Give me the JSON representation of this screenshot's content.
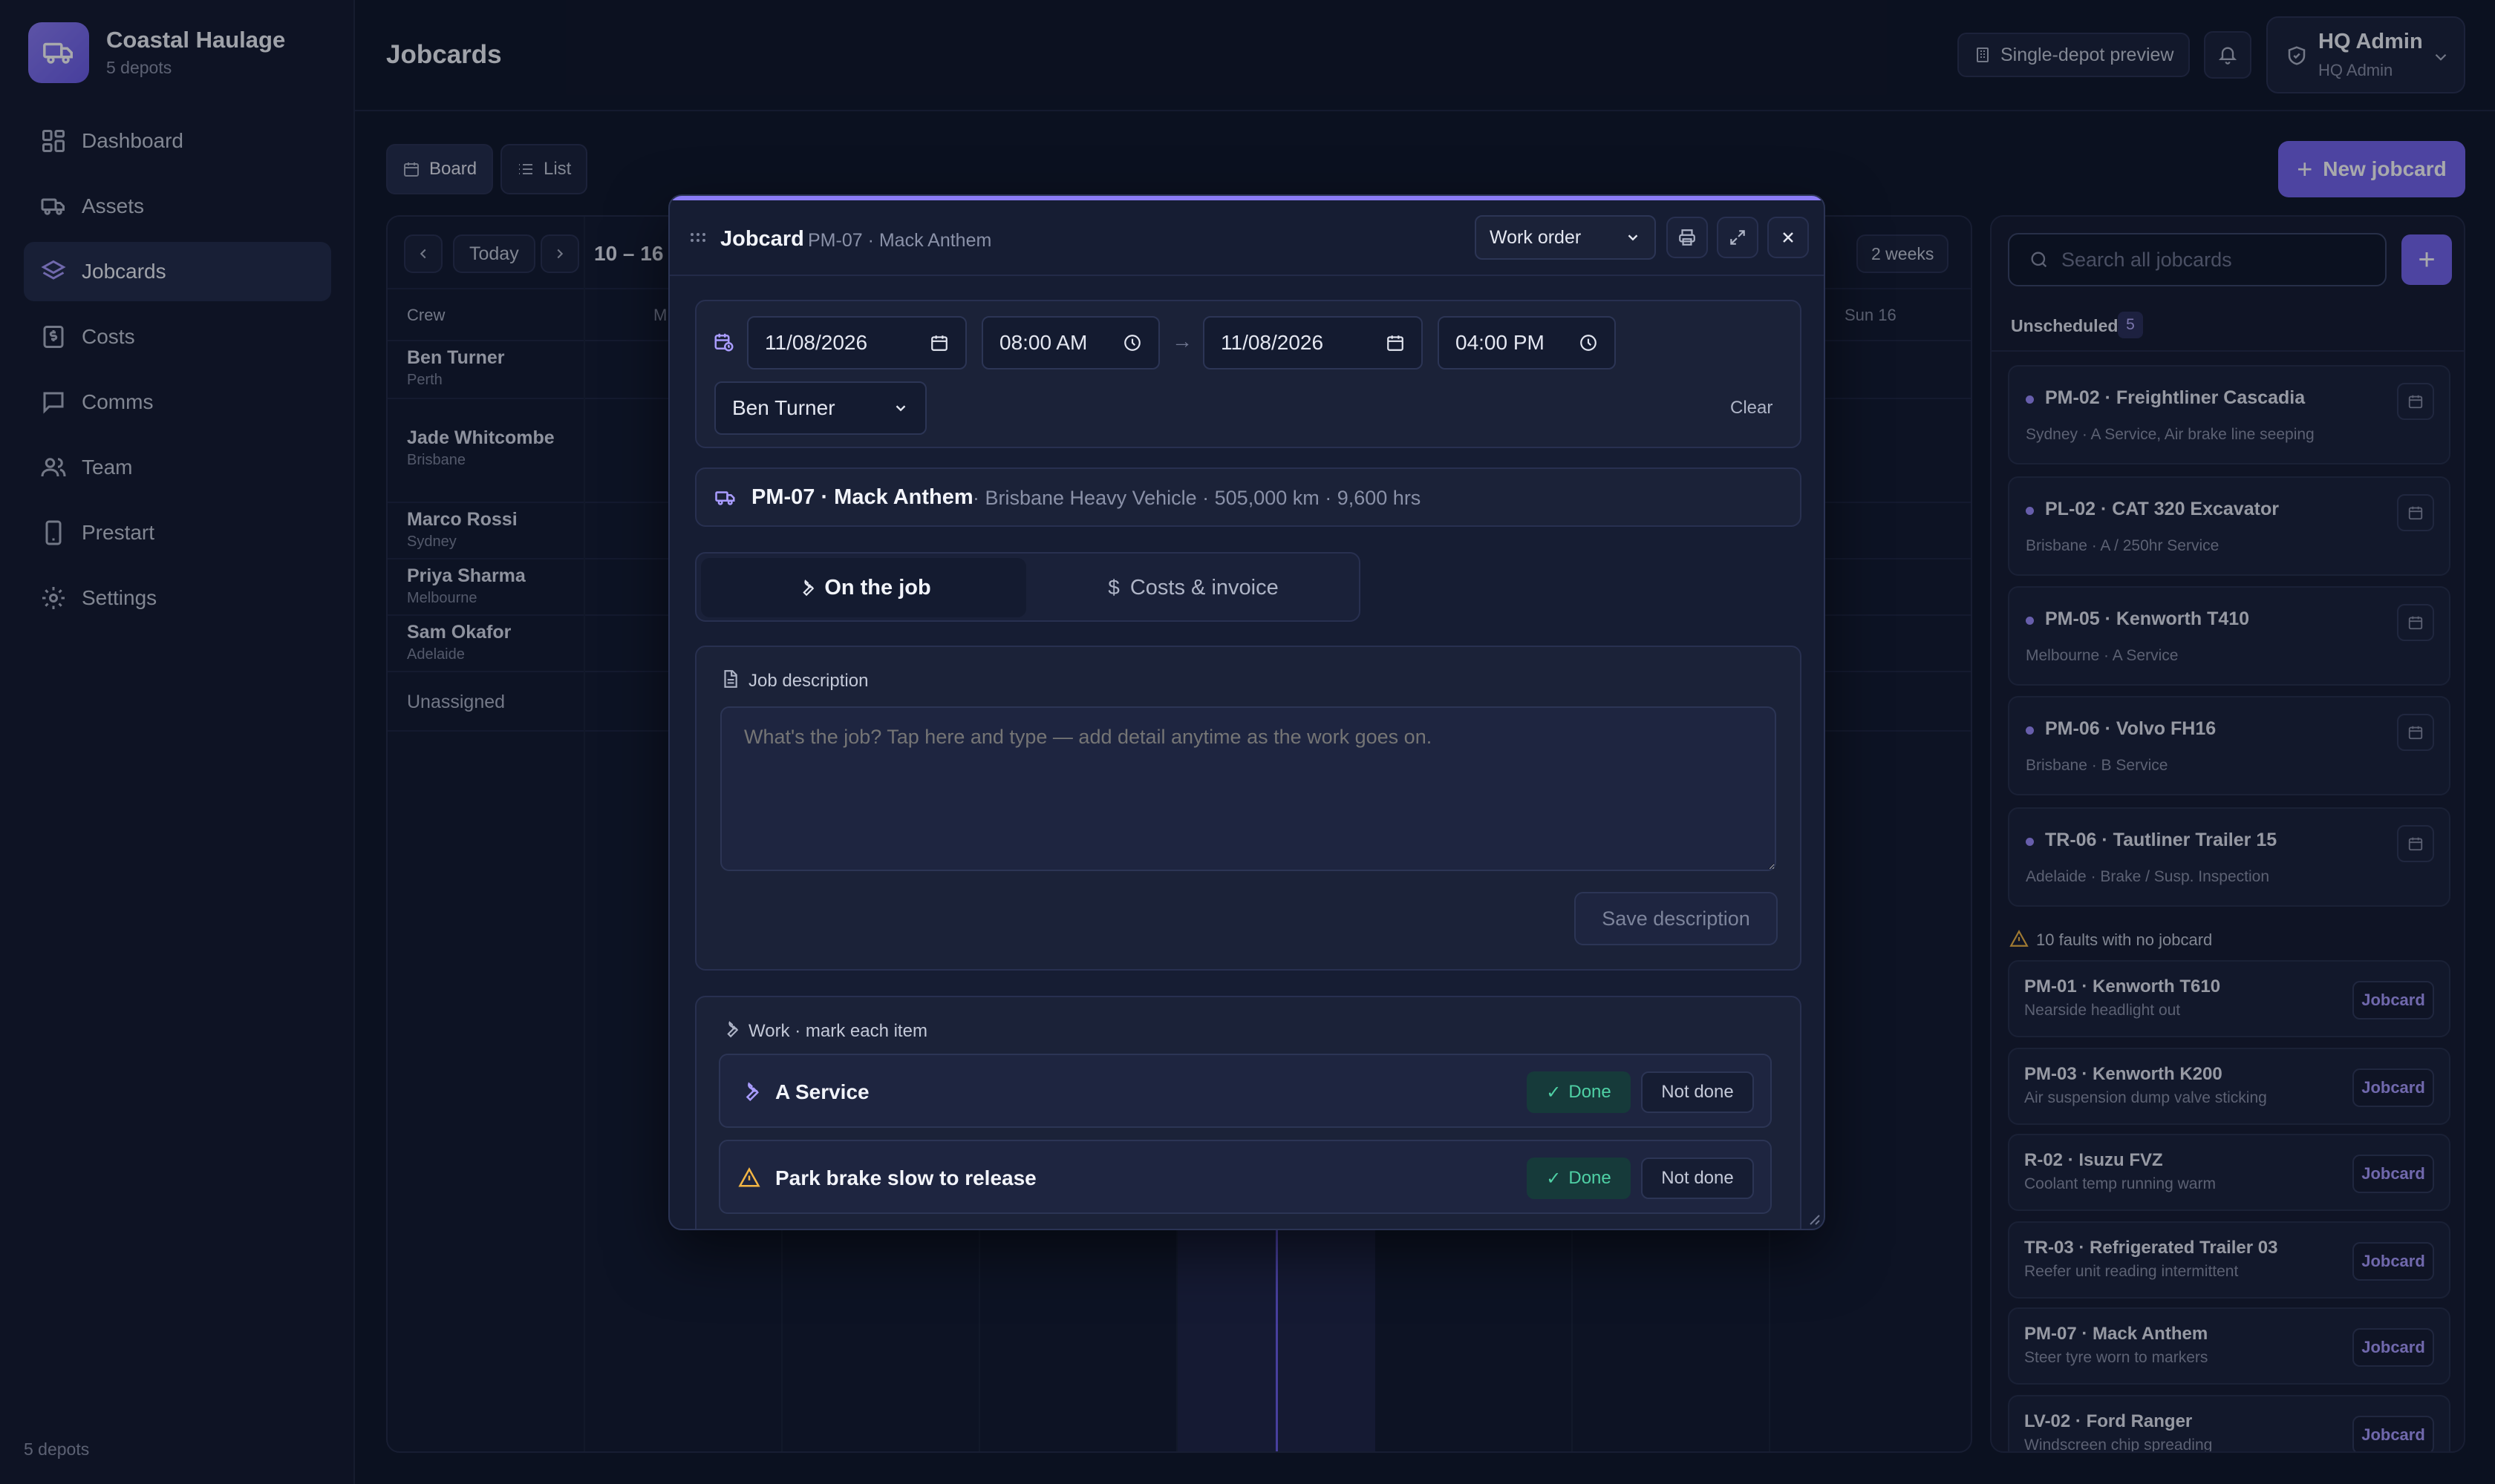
{
  "brand": {
    "name": "Coastal Haulage",
    "sub": "5 depots"
  },
  "nav": [
    {
      "label": "Dashboard",
      "icon": "dashboard-icon"
    },
    {
      "label": "Assets",
      "icon": "truck-icon"
    },
    {
      "label": "Jobcards",
      "icon": "layers-icon",
      "active": true
    },
    {
      "label": "Costs",
      "icon": "dollar-icon"
    },
    {
      "label": "Comms",
      "icon": "chat-icon"
    },
    {
      "label": "Team",
      "icon": "users-icon"
    },
    {
      "label": "Prestart",
      "icon": "phone-icon"
    },
    {
      "label": "Settings",
      "icon": "gear-icon"
    }
  ],
  "sidebar_footer": "5 depots",
  "header": {
    "title": "Jobcards",
    "preview_label": "Single-depot preview",
    "user_name": "HQ Admin",
    "user_role": "HQ Admin"
  },
  "toolbar": {
    "board_label": "Board",
    "list_label": "List",
    "new_jobcard": "New jobcard"
  },
  "board": {
    "today_label": "Today",
    "range_label": "10 – 16 /",
    "weeks_label": "2 weeks",
    "crew_header": "Crew",
    "day_first": "M",
    "day_last": "Sun 16",
    "crew": [
      {
        "name": "Ben Turner",
        "depot": "Perth"
      },
      {
        "name": "Jade Whitcombe",
        "depot": "Brisbane"
      },
      {
        "name": "Marco Rossi",
        "depot": "Sydney"
      },
      {
        "name": "Priya Sharma",
        "depot": "Melbourne"
      },
      {
        "name": "Sam Okafor",
        "depot": "Adelaide"
      }
    ],
    "unassigned_label": "Unassigned"
  },
  "right_panel": {
    "search_placeholder": "Search all jobcards",
    "unscheduled_label": "Unscheduled",
    "unscheduled_count": "5",
    "unscheduled": [
      {
        "title": "PM-02 · Freightliner Cascadia",
        "sub": "Sydney · A Service, Air brake line seeping"
      },
      {
        "title": "PL-02 · CAT 320 Excavator",
        "sub": "Brisbane · A / 250hr Service"
      },
      {
        "title": "PM-05 · Kenworth T410",
        "sub": "Melbourne · A Service"
      },
      {
        "title": "PM-06 · Volvo FH16",
        "sub": "Brisbane · B Service"
      },
      {
        "title": "TR-06 · Tautliner Trailer 15",
        "sub": "Adelaide · Brake / Susp. Inspection"
      }
    ],
    "faults_label": "10 faults with no jobcard",
    "fault_button": "Jobcard",
    "faults": [
      {
        "title": "PM-01 · Kenworth T610",
        "sub": "Nearside headlight out"
      },
      {
        "title": "PM-03 · Kenworth K200",
        "sub": "Air suspension dump valve sticking"
      },
      {
        "title": "R-02 · Isuzu FVZ",
        "sub": "Coolant temp running warm"
      },
      {
        "title": "TR-03 · Refrigerated Trailer 03",
        "sub": "Reefer unit reading intermittent"
      },
      {
        "title": "PM-07 · Mack Anthem",
        "sub": "Steer tyre worn to markers"
      },
      {
        "title": "LV-02 · Ford Ranger",
        "sub": "Windscreen chip spreading"
      }
    ]
  },
  "modal": {
    "title": "Jobcard",
    "subtitle": "PM-07 · Mack Anthem",
    "type_select": "Work order",
    "start_date": "11/08/2026",
    "start_time": "08:00 AM",
    "arrow": "→",
    "end_date": "11/08/2026",
    "end_time": "04:00 PM",
    "assignee": "Ben Turner",
    "clear_label": "Clear",
    "asset_title": "PM-07 · Mack Anthem",
    "asset_meta": "· Brisbane Heavy Vehicle · 505,000 km · 9,600 hrs",
    "tab_job": "On the job",
    "tab_costs": "Costs & invoice",
    "desc_label": "Job description",
    "desc_placeholder": "What's the job? Tap here and type — add detail anytime as the work goes on.",
    "save_desc": "Save description",
    "work_label": "Work · mark each item",
    "work_items": [
      {
        "label": "A Service",
        "icon": "wrench-icon"
      },
      {
        "label": "Park brake slow to release",
        "icon": "warning-icon"
      }
    ],
    "done_label": "Done",
    "not_done_label": "Not done"
  },
  "colors": {
    "accent": "#7464ee",
    "done": "#4fd1a5",
    "warning": "#f2b544"
  }
}
